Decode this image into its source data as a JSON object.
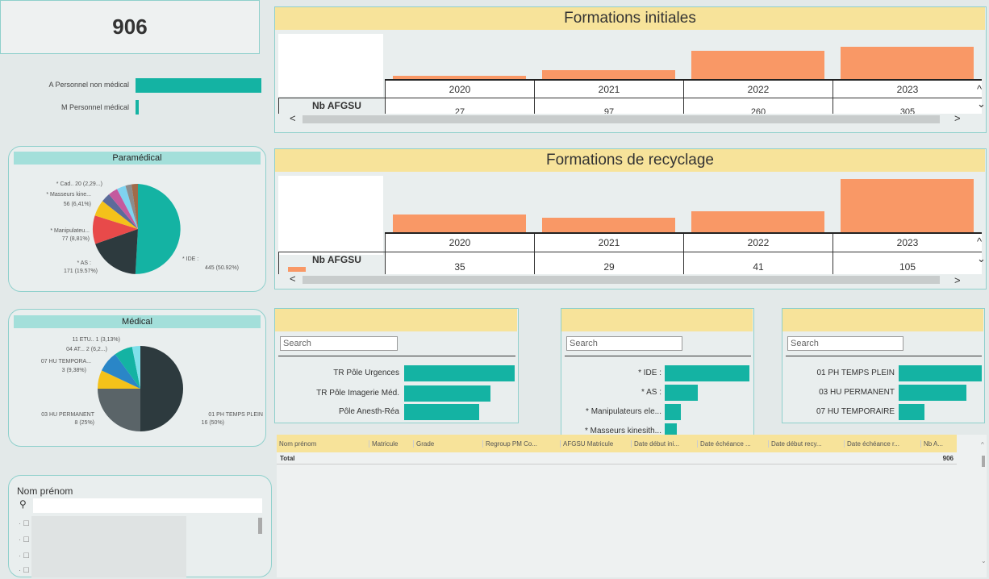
{
  "kpi": {
    "value": "906"
  },
  "personnel": {
    "items": [
      {
        "label": "A Personnel non médical",
        "fraction": 1.0
      },
      {
        "label": "M Personnel médical",
        "fraction": 0.03
      }
    ]
  },
  "paramedical": {
    "title": "Paramédical",
    "labels": {
      "cad_1": "* Cad.. 20 (2,29...)",
      "mass_1": "* Masseurs kine...",
      "mass_2": "56 (6,41%)",
      "manip_1": "* Manipulateu...",
      "manip_2": "77 (8,81%)",
      "as_1": "* AS :",
      "as_2": "171 (19.57%)",
      "ide_1": "* IDE :",
      "ide_2": "445 (50.92%)"
    }
  },
  "medical": {
    "title": "Médical",
    "labels": {
      "etu": "11 ETU.. 1 (3,13%)",
      "at": "04 AT... 2 (6,2...)",
      "temp_1": "07 HU TEMPORA...",
      "temp_2": "3 (9,38%)",
      "hu_1": "03 HU PERMANENT",
      "hu_2": "8 (25%)",
      "ph_1": "01 PH TEMPS PLEIN",
      "ph_2": "16 (50%)"
    }
  },
  "nom_filter": {
    "label": "Nom prénom"
  },
  "formations_initiales": {
    "title": "Formations initiales",
    "years": [
      "2020",
      "2021",
      "2022",
      "2023"
    ],
    "row_label": "Nb AFGSU",
    "values": [
      "27",
      "97",
      "260",
      "305"
    ],
    "bar_heights": [
      0.08,
      0.22,
      0.68,
      0.77
    ]
  },
  "formations_recyclage": {
    "title": "Formations de recyclage",
    "years": [
      "2020",
      "2021",
      "2022",
      "2023"
    ],
    "row_label": "Nb AFGSU",
    "values": [
      "35",
      "29",
      "41",
      "105"
    ],
    "bar_heights": [
      0.33,
      0.27,
      0.39,
      1.0
    ]
  },
  "slicers": {
    "search_placeholder": "Search",
    "pole": [
      {
        "label": "TR Pôle Urgences",
        "fraction": 1.0
      },
      {
        "label": "TR Pôle Imagerie Méd.",
        "fraction": 0.78
      },
      {
        "label": "Pôle Anesth-Réa",
        "fraction": 0.68
      }
    ],
    "grade": [
      {
        "label": "* IDE :",
        "fraction": 1.0
      },
      {
        "label": "* AS :",
        "fraction": 0.39
      },
      {
        "label": "* Manipulateurs ele...",
        "fraction": 0.18
      },
      {
        "label": "* Masseurs kinesith...",
        "fraction": 0.13
      }
    ],
    "statut": [
      {
        "label": "01 PH TEMPS PLEIN",
        "fraction": 1.0
      },
      {
        "label": "03 HU PERMANENT",
        "fraction": 0.82
      },
      {
        "label": "07 HU TEMPORAIRE",
        "fraction": 0.31
      }
    ]
  },
  "table": {
    "headers": [
      "Nom prénom",
      "Matricule",
      "Grade",
      "Regroup PM Co...",
      "AFGSU Matricule",
      "Date début ini...",
      "Date échéance ...",
      "Date début recy...",
      "Date échéance r...",
      "Nb A..."
    ],
    "total_label": "Total",
    "total_value": "906"
  }
}
